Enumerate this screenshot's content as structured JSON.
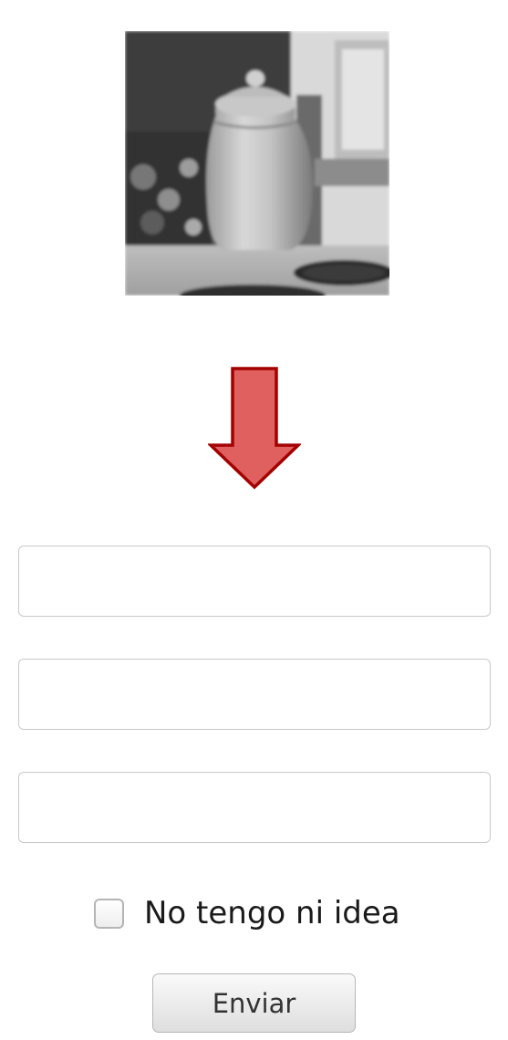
{
  "captcha_image": {
    "icon": "jar-photo",
    "style": "grayscale"
  },
  "arrow": {
    "icon": "down-arrow-icon",
    "fill": "#e06060",
    "stroke": "#a30000"
  },
  "form": {
    "fields": [
      {
        "value": "",
        "placeholder": ""
      },
      {
        "value": "",
        "placeholder": ""
      },
      {
        "value": "",
        "placeholder": ""
      }
    ],
    "checkbox": {
      "label": "No tengo ni idea",
      "checked": false
    },
    "submit_label": "Enviar"
  }
}
